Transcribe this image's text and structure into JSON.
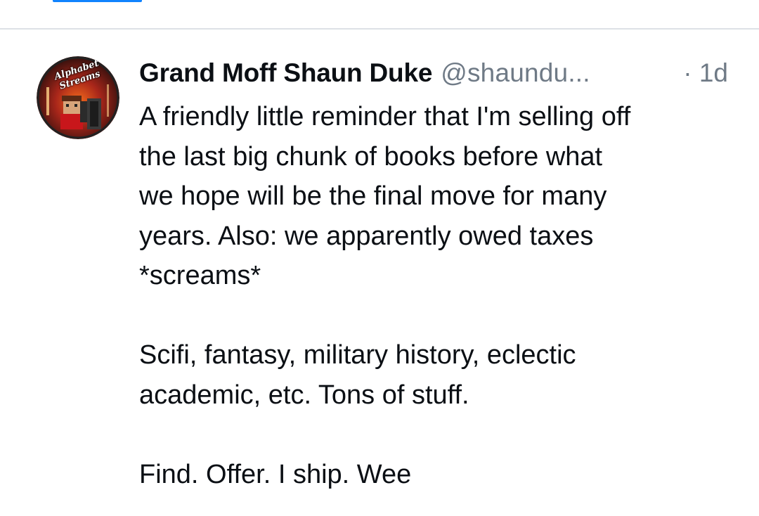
{
  "post": {
    "author_name": "Grand Moff Shaun Duke",
    "author_handle": "@shaundu...",
    "timestamp": "· 1d",
    "avatar_icon": "alphabet-streams-avatar",
    "avatar_logo_text": "Alphabet Streams",
    "paragraphs": [
      "A friendly little reminder that I'm selling off\nthe last big chunk of books before what\nwe hope will be the final move for many\nyears. Also: we apparently owed taxes\n*screams*",
      "Scifi, fantasy, military history, eclectic\nacademic, etc. Tons of stuff.",
      "Find. Offer. I ship. Wee"
    ]
  },
  "colors": {
    "accent": "#1083fe",
    "muted_text": "#6f7a86",
    "text": "#0b0f14",
    "divider": "#dde1e6"
  }
}
